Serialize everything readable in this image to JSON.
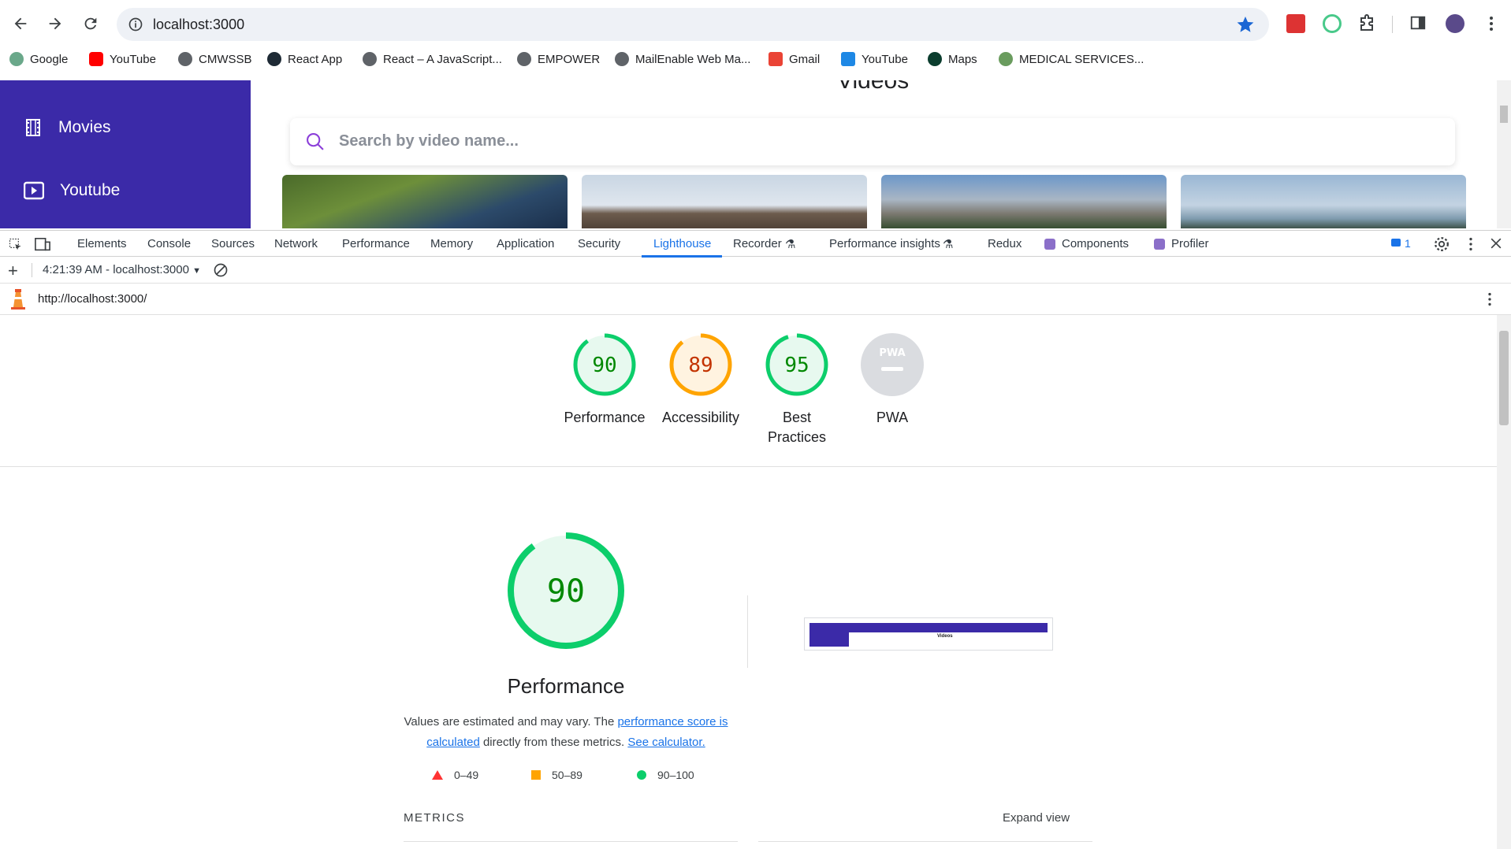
{
  "browser": {
    "url": "localhost:3000",
    "bookmarks": [
      {
        "label": "Google",
        "color": "#6aa88a"
      },
      {
        "label": "YouTube",
        "color": "#ff0000"
      },
      {
        "label": "CMWSSB",
        "color": "#5f6368"
      },
      {
        "label": "React App",
        "color": "#1e2a35"
      },
      {
        "label": "React – A JavaScript...",
        "color": "#5f6368"
      },
      {
        "label": "EMPOWER",
        "color": "#5f6368"
      },
      {
        "label": "MailEnable Web Ma...",
        "color": "#5f6368"
      },
      {
        "label": "Gmail",
        "color": "#ea4335"
      },
      {
        "label": "YouTube",
        "color": "#1e88e5"
      },
      {
        "label": "Maps",
        "color": "#0b3d2e"
      },
      {
        "label": "MEDICAL SERVICES...",
        "color": "#6a9c5e"
      }
    ]
  },
  "app": {
    "sidebar": [
      {
        "label": "Movies",
        "icon": "film-icon"
      },
      {
        "label": "Youtube",
        "icon": "youtube-icon"
      }
    ],
    "title": "Videos",
    "search_placeholder": "Search by video name..."
  },
  "devtools": {
    "tabs": [
      "Elements",
      "Console",
      "Sources",
      "Network",
      "Performance",
      "Memory",
      "Application",
      "Security",
      "Lighthouse",
      "Recorder",
      "Performance insights",
      "Redux",
      "Components",
      "Profiler"
    ],
    "active_tab": "Lighthouse",
    "issues_count": "1",
    "report_selector": "4:21:39 AM - localhost:3000",
    "report_url": "http://localhost:3000/"
  },
  "lighthouse": {
    "categories": [
      {
        "score": "90",
        "label": "Performance",
        "color": "#0cce6b",
        "text_color": "#008800"
      },
      {
        "score": "89",
        "label": "Accessibility",
        "color": "#ffa400",
        "text_color": "#c33300"
      },
      {
        "score": "95",
        "label": "Best Practices",
        "color": "#0cce6b",
        "text_color": "#008800"
      },
      {
        "score": "PWA",
        "label": "PWA",
        "color": "#cccccc",
        "text_color": "#ffffff"
      }
    ],
    "main": {
      "score": "90",
      "score_fraction": 0.9,
      "title": "Performance",
      "desc_1": "Values are estimated and may vary. The ",
      "desc_link_1": "performance score is calculated",
      "desc_2": " directly from these metrics. ",
      "desc_link_2": "See calculator."
    },
    "legend": [
      {
        "range": "0–49",
        "color": "#ff3333"
      },
      {
        "range": "50–89",
        "color": "#ffa400"
      },
      {
        "range": "90–100",
        "color": "#0cce6b"
      }
    ],
    "metrics_label": "METRICS",
    "expand_label": "Expand view",
    "screenshot_text": "Videos"
  }
}
